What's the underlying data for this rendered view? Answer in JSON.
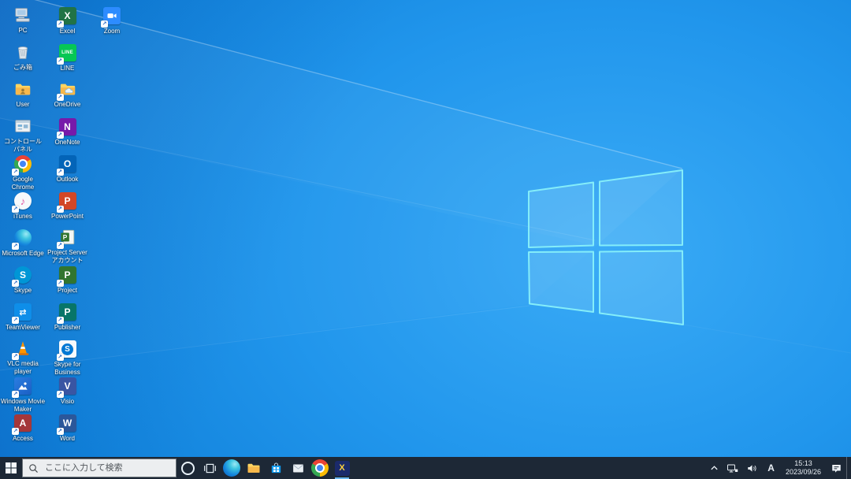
{
  "desktop": {
    "wallpaper": {
      "base_color": "#2196ec",
      "bright_color": "#3aabf6",
      "dark_color": "#0b63c2",
      "logo_stroke_color": "#84edf9",
      "logo": "windows-logo"
    },
    "icons": [
      {
        "id": "desktop-icon-pc",
        "label": "PC",
        "glyph": "monitor",
        "col": 0,
        "row": 0,
        "shortcut": false
      },
      {
        "id": "desktop-icon-excel",
        "label": "Excel",
        "glyph": "tile",
        "letter": "X",
        "color": "#217346",
        "col": 1,
        "row": 0,
        "shortcut": true
      },
      {
        "id": "desktop-icon-zoom",
        "label": "Zoom",
        "glyph": "zoom",
        "color": "#2d8cff",
        "col": 2,
        "row": 0,
        "shortcut": true
      },
      {
        "id": "desktop-icon-recycle-bin",
        "label": "ごみ箱",
        "glyph": "trash",
        "col": 0,
        "row": 1,
        "shortcut": false
      },
      {
        "id": "desktop-icon-line",
        "label": "LINE",
        "glyph": "line",
        "color": "#06c755",
        "col": 1,
        "row": 1,
        "shortcut": true
      },
      {
        "id": "desktop-icon-user",
        "label": "User",
        "glyph": "user-folder",
        "col": 0,
        "row": 2,
        "shortcut": false
      },
      {
        "id": "desktop-icon-onedrive",
        "label": "OneDrive",
        "glyph": "onedrive",
        "col": 1,
        "row": 2,
        "shortcut": true
      },
      {
        "id": "desktop-icon-control-panel",
        "label": "コントロール パネル",
        "glyph": "control",
        "col": 0,
        "row": 3,
        "shortcut": false
      },
      {
        "id": "desktop-icon-onenote",
        "label": "OneNote",
        "glyph": "tile",
        "letter": "N",
        "color": "#7719aa",
        "col": 1,
        "row": 3,
        "shortcut": true
      },
      {
        "id": "desktop-icon-google-chrome",
        "label": "Google Chrome",
        "glyph": "chrome",
        "col": 0,
        "row": 4,
        "shortcut": true
      },
      {
        "id": "desktop-icon-outlook",
        "label": "Outlook",
        "glyph": "tile",
        "letter": "O",
        "color": "#0364b8",
        "col": 1,
        "row": 4,
        "shortcut": true
      },
      {
        "id": "desktop-icon-itunes",
        "label": "iTunes",
        "glyph": "itunes",
        "col": 0,
        "row": 5,
        "shortcut": true
      },
      {
        "id": "desktop-icon-powerpoint",
        "label": "PowerPoint",
        "glyph": "tile",
        "letter": "P",
        "color": "#d24726",
        "col": 1,
        "row": 5,
        "shortcut": true
      },
      {
        "id": "desktop-icon-microsoft-edge",
        "label": "Microsoft Edge",
        "glyph": "edge",
        "col": 0,
        "row": 6,
        "shortcut": true
      },
      {
        "id": "desktop-icon-project-server-accounts",
        "label": "Project Server アカウント",
        "glyph": "projectserver",
        "col": 1,
        "row": 6,
        "shortcut": true
      },
      {
        "id": "desktop-icon-skype",
        "label": "Skype",
        "glyph": "skype",
        "color": "#0096d6",
        "col": 0,
        "row": 7,
        "shortcut": true
      },
      {
        "id": "desktop-icon-project",
        "label": "Project",
        "glyph": "tile",
        "letter": "P",
        "color": "#31752f",
        "col": 1,
        "row": 7,
        "shortcut": true
      },
      {
        "id": "desktop-icon-teamviewer",
        "label": "TeamViewer",
        "glyph": "teamviewer",
        "color": "#0e8ee9",
        "col": 0,
        "row": 8,
        "shortcut": true
      },
      {
        "id": "desktop-icon-publisher",
        "label": "Publisher",
        "glyph": "tile",
        "letter": "P",
        "color": "#077568",
        "col": 1,
        "row": 8,
        "shortcut": true
      },
      {
        "id": "desktop-icon-vlc-media-player",
        "label": "VLC media player",
        "glyph": "vlc",
        "col": 0,
        "row": 9,
        "shortcut": true
      },
      {
        "id": "desktop-icon-skype-for-business",
        "label": "Skype for Business",
        "glyph": "sfb",
        "col": 1,
        "row": 9,
        "shortcut": true
      },
      {
        "id": "desktop-icon-windows-movie-maker",
        "label": "Windows Movie Maker",
        "glyph": "moviemaker",
        "col": 0,
        "row": 10,
        "shortcut": true
      },
      {
        "id": "desktop-icon-visio",
        "label": "Visio",
        "glyph": "tile",
        "letter": "V",
        "color": "#3955a3",
        "col": 1,
        "row": 10,
        "shortcut": true
      },
      {
        "id": "desktop-icon-access",
        "label": "Access",
        "glyph": "tile",
        "letter": "A",
        "color": "#a4373a",
        "col": 0,
        "row": 11,
        "shortcut": true
      },
      {
        "id": "desktop-icon-word",
        "label": "Word",
        "glyph": "tile",
        "letter": "W",
        "color": "#2b579a",
        "col": 1,
        "row": 11,
        "shortcut": true
      }
    ]
  },
  "taskbar": {
    "bg_color": "#1d2836",
    "start": {
      "icon": "windows-start-icon"
    },
    "search": {
      "placeholder": "ここに入力して検索",
      "icon": "search-icon"
    },
    "buttons": [
      {
        "id": "cortana-button",
        "glyph": "cortana",
        "running": false
      },
      {
        "id": "task-view-button",
        "glyph": "taskview",
        "running": false
      },
      {
        "id": "taskbar-edge-button",
        "glyph": "edge",
        "running": false
      },
      {
        "id": "taskbar-file-explorer-button",
        "glyph": "folder",
        "running": false
      },
      {
        "id": "taskbar-store-button",
        "glyph": "store",
        "running": false
      },
      {
        "id": "taskbar-mail-button",
        "glyph": "mail",
        "running": false
      },
      {
        "id": "taskbar-chrome-button",
        "glyph": "chrome",
        "running": false
      },
      {
        "id": "taskbar-pinned-app-button",
        "glyph": "appx",
        "running": true
      }
    ],
    "tray": {
      "chevron_icon": "chevron-up-icon",
      "network_icon": "network-icon",
      "volume_icon": "volume-icon",
      "ime": "A",
      "time": "15:13",
      "date": "2023/09/26",
      "notification_icon": "action-center-icon"
    }
  }
}
